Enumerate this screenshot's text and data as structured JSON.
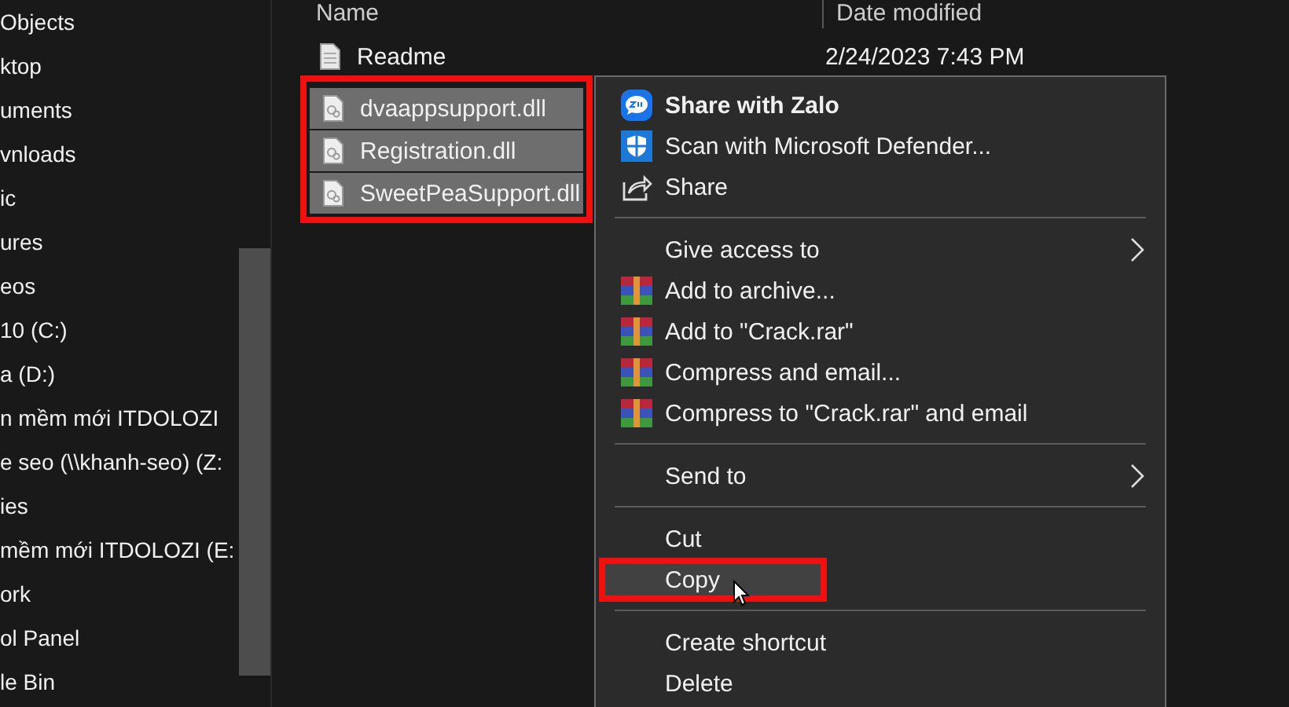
{
  "sidebar": {
    "items": [
      {
        "label": "Objects"
      },
      {
        "label": "ktop"
      },
      {
        "label": "uments"
      },
      {
        "label": "vnloads"
      },
      {
        "label": "ic"
      },
      {
        "label": "ures"
      },
      {
        "label": "eos"
      },
      {
        "label": "10 (C:)"
      },
      {
        "label": "a (D:)"
      },
      {
        "label": "n mềm mới ITDOLOZI"
      },
      {
        "label": "e seo (\\\\khanh-seo) (Z:"
      },
      {
        "label": "ies"
      },
      {
        "label": "mềm mới ITDOLOZI (E:"
      },
      {
        "label": "ork"
      },
      {
        "label": "ol Panel"
      },
      {
        "label": "le Bin"
      }
    ]
  },
  "file_list": {
    "columns": [
      "Name",
      "Date modified"
    ],
    "callout_on_selection": true,
    "files": [
      {
        "name": "Readme",
        "date": "2/24/2023 7:43 PM",
        "kind": "document",
        "selected": false
      },
      {
        "name": "dvaappsupport.dll",
        "kind": "library",
        "selected": true
      },
      {
        "name": "Registration.dll",
        "kind": "library",
        "selected": true
      },
      {
        "name": "SweetPeaSupport.dll",
        "kind": "library",
        "selected": true
      }
    ]
  },
  "context_menu": {
    "items": [
      {
        "kind": "zalo",
        "label": "Share with Zalo",
        "bold": true,
        "selected": false
      },
      {
        "kind": "defender",
        "label": "Scan with Microsoft Defender...",
        "selected": false
      },
      {
        "kind": "share",
        "label": "Share",
        "selected": false
      },
      {
        "kind": "separator"
      },
      {
        "kind": "submenu",
        "label": "Give access to",
        "selected": false
      },
      {
        "kind": "archive",
        "label": "Add to archive...",
        "selected": false
      },
      {
        "kind": "archive",
        "label": "Add to \"Crack.rar\"",
        "selected": false
      },
      {
        "kind": "archive",
        "label": "Compress and email...",
        "selected": false
      },
      {
        "kind": "archive",
        "label": "Compress to \"Crack.rar\" and email",
        "selected": false
      },
      {
        "kind": "separator"
      },
      {
        "kind": "submenu",
        "label": "Send to",
        "selected": false
      },
      {
        "kind": "separator"
      },
      {
        "kind": "plain",
        "label": "Cut",
        "selected": false
      },
      {
        "kind": "plain",
        "label": "Copy",
        "selected": true,
        "callout": true
      },
      {
        "kind": "separator"
      },
      {
        "kind": "plain",
        "label": "Create shortcut",
        "selected": false
      },
      {
        "kind": "plain",
        "label": "Delete",
        "selected": false
      }
    ]
  }
}
